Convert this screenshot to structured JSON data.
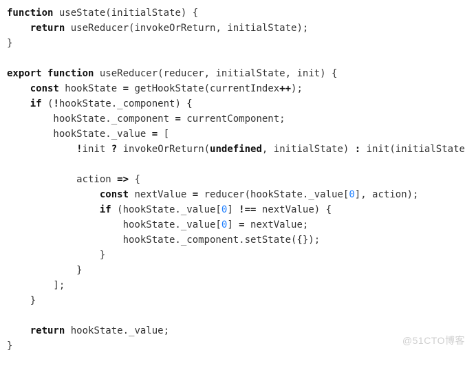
{
  "watermark": "@51CTO博客",
  "code": {
    "tokens": [
      [
        "kw",
        "function"
      ],
      [
        "t",
        " useState(initialState) {\n"
      ],
      [
        "t",
        "    "
      ],
      [
        "kw",
        "return"
      ],
      [
        "t",
        " useReducer(invokeOrReturn, initialState);\n"
      ],
      [
        "t",
        "}\n"
      ],
      [
        "t",
        "\n"
      ],
      [
        "kw",
        "export"
      ],
      [
        "t",
        " "
      ],
      [
        "kw",
        "function"
      ],
      [
        "t",
        " useReducer(reducer, initialState, init) {\n"
      ],
      [
        "t",
        "    "
      ],
      [
        "kw",
        "const"
      ],
      [
        "t",
        " hookState "
      ],
      [
        "kw",
        "="
      ],
      [
        "t",
        " getHookState(currentIndex"
      ],
      [
        "kw",
        "++"
      ],
      [
        "t",
        ");\n"
      ],
      [
        "t",
        "    "
      ],
      [
        "kw",
        "if"
      ],
      [
        "t",
        " ("
      ],
      [
        "kw",
        "!"
      ],
      [
        "t",
        "hookState._component) {\n"
      ],
      [
        "t",
        "        hookState._component "
      ],
      [
        "kw",
        "="
      ],
      [
        "t",
        " currentComponent;\n"
      ],
      [
        "t",
        "        hookState._value "
      ],
      [
        "kw",
        "="
      ],
      [
        "t",
        " [\n"
      ],
      [
        "t",
        "            "
      ],
      [
        "kw",
        "!"
      ],
      [
        "t",
        "init "
      ],
      [
        "kw",
        "?"
      ],
      [
        "t",
        " invokeOrReturn("
      ],
      [
        "kw",
        "undefined"
      ],
      [
        "t",
        ", initialState) "
      ],
      [
        "kw",
        ":"
      ],
      [
        "t",
        " init(initialState\n"
      ],
      [
        "t",
        "\n"
      ],
      [
        "t",
        "            action "
      ],
      [
        "kw",
        "=>"
      ],
      [
        "t",
        " {\n"
      ],
      [
        "t",
        "                "
      ],
      [
        "kw",
        "const"
      ],
      [
        "t",
        " nextValue "
      ],
      [
        "kw",
        "="
      ],
      [
        "t",
        " reducer(hookState._value["
      ],
      [
        "num",
        "0"
      ],
      [
        "t",
        "], action);\n"
      ],
      [
        "t",
        "                "
      ],
      [
        "kw",
        "if"
      ],
      [
        "t",
        " (hookState._value["
      ],
      [
        "num",
        "0"
      ],
      [
        "t",
        "] "
      ],
      [
        "kw",
        "!=="
      ],
      [
        "t",
        " nextValue) {\n"
      ],
      [
        "t",
        "                    hookState._value["
      ],
      [
        "num",
        "0"
      ],
      [
        "t",
        "] "
      ],
      [
        "kw",
        "="
      ],
      [
        "t",
        " nextValue;\n"
      ],
      [
        "t",
        "                    hookState._component.setState({});\n"
      ],
      [
        "t",
        "                }\n"
      ],
      [
        "t",
        "            }\n"
      ],
      [
        "t",
        "        ];\n"
      ],
      [
        "t",
        "    }\n"
      ],
      [
        "t",
        "\n"
      ],
      [
        "t",
        "    "
      ],
      [
        "kw",
        "return"
      ],
      [
        "t",
        " hookState._value;\n"
      ],
      [
        "t",
        "}"
      ]
    ]
  }
}
